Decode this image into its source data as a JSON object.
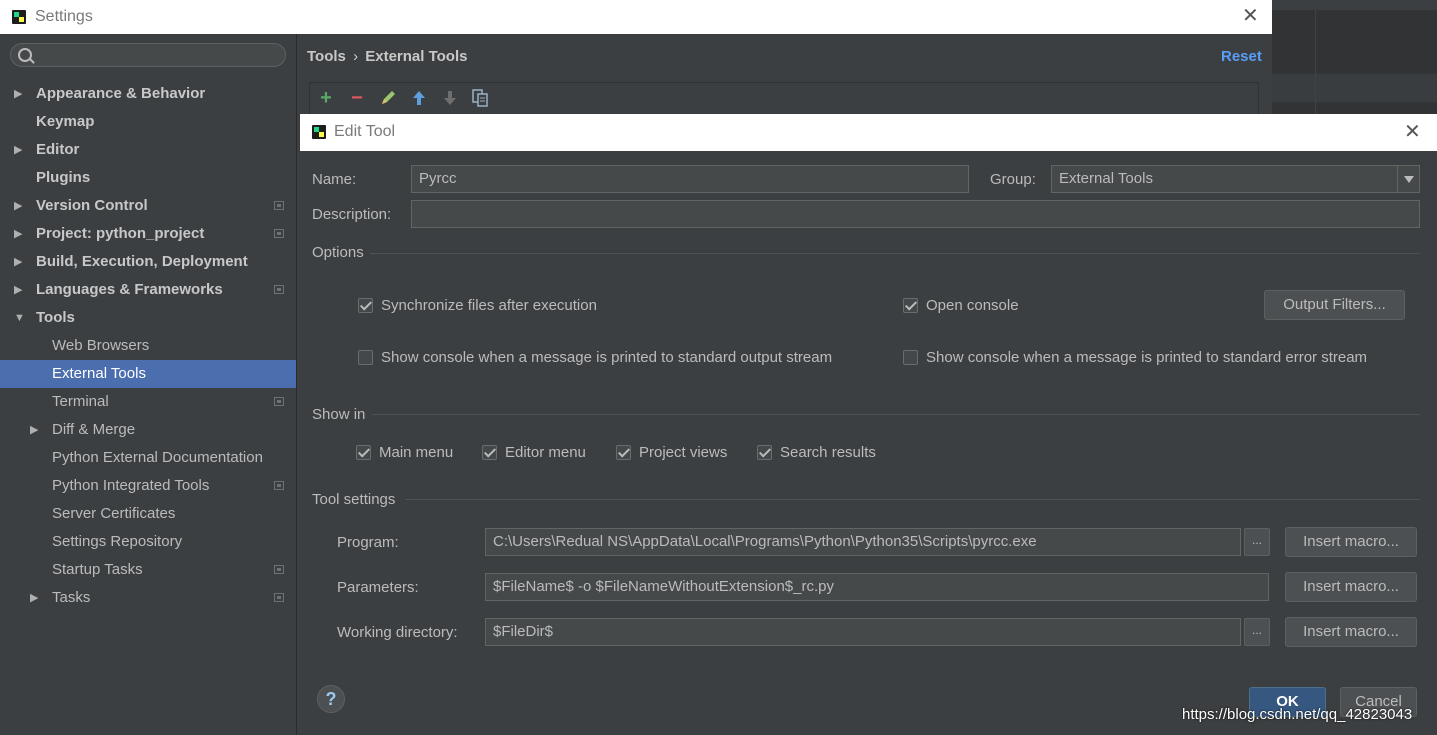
{
  "settings": {
    "title": "Settings",
    "search": {
      "placeholder": ""
    },
    "tree": [
      {
        "label": "Appearance & Behavior",
        "level": 0,
        "expandable": true,
        "bold": true,
        "project": false
      },
      {
        "label": "Keymap",
        "level": 0,
        "expandable": false,
        "bold": true,
        "project": false
      },
      {
        "label": "Editor",
        "level": 0,
        "expandable": true,
        "bold": true,
        "project": false
      },
      {
        "label": "Plugins",
        "level": 0,
        "expandable": false,
        "bold": true,
        "project": false
      },
      {
        "label": "Version Control",
        "level": 0,
        "expandable": true,
        "bold": true,
        "project": true
      },
      {
        "label": "Project: python_project",
        "level": 0,
        "expandable": true,
        "bold": true,
        "project": true
      },
      {
        "label": "Build, Execution, Deployment",
        "level": 0,
        "expandable": true,
        "bold": true,
        "project": false
      },
      {
        "label": "Languages & Frameworks",
        "level": 0,
        "expandable": true,
        "bold": true,
        "project": true
      },
      {
        "label": "Tools",
        "level": 0,
        "expandable": true,
        "expanded": true,
        "bold": true,
        "project": false
      },
      {
        "label": "Web Browsers",
        "level": 1,
        "expandable": false,
        "bold": false,
        "project": false
      },
      {
        "label": "External Tools",
        "level": 1,
        "expandable": false,
        "bold": false,
        "project": false,
        "selected": true
      },
      {
        "label": "Terminal",
        "level": 1,
        "expandable": false,
        "bold": false,
        "project": true
      },
      {
        "label": "Diff & Merge",
        "level": 1,
        "expandable": true,
        "bold": false,
        "project": false
      },
      {
        "label": "Python External Documentation",
        "level": 1,
        "expandable": false,
        "bold": false,
        "project": false
      },
      {
        "label": "Python Integrated Tools",
        "level": 1,
        "expandable": false,
        "bold": false,
        "project": true
      },
      {
        "label": "Server Certificates",
        "level": 1,
        "expandable": false,
        "bold": false,
        "project": false
      },
      {
        "label": "Settings Repository",
        "level": 1,
        "expandable": false,
        "bold": false,
        "project": false
      },
      {
        "label": "Startup Tasks",
        "level": 1,
        "expandable": false,
        "bold": false,
        "project": true
      },
      {
        "label": "Tasks",
        "level": 1,
        "expandable": true,
        "bold": false,
        "project": true
      }
    ],
    "breadcrumb": {
      "parent": "Tools",
      "separator": "›",
      "current": "External Tools"
    },
    "reset_label": "Reset",
    "toolbar_icons": [
      "add-icon",
      "remove-icon",
      "edit-icon",
      "move-up-icon",
      "move-down-icon",
      "copy-icon"
    ]
  },
  "dialog": {
    "title": "Edit Tool",
    "name_label": "Name:",
    "name_value": "Pyrcc",
    "group_label": "Group:",
    "group_value": "External Tools",
    "description_label": "Description:",
    "description_value": "",
    "options": {
      "title": "Options",
      "sync_files": {
        "label": "Synchronize files after execution",
        "checked": true
      },
      "open_console": {
        "label": "Open console",
        "checked": true
      },
      "output_filters_label": "Output Filters...",
      "show_console_stdout": {
        "label": "Show console when a message is printed to standard output stream",
        "checked": false
      },
      "show_console_stderr": {
        "label": "Show console when a message is printed to standard error stream",
        "checked": false
      }
    },
    "show_in": {
      "title": "Show in",
      "items": [
        {
          "label": "Main menu",
          "checked": true
        },
        {
          "label": "Editor menu",
          "checked": true
        },
        {
          "label": "Project views",
          "checked": true
        },
        {
          "label": "Search results",
          "checked": true
        }
      ]
    },
    "tool_settings": {
      "title": "Tool settings",
      "program_label": "Program:",
      "program_value": "C:\\Users\\Redual NS\\AppData\\Local\\Programs\\Python\\Python35\\Scripts\\pyrcc.exe",
      "parameters_label": "Parameters:",
      "parameters_value": "$FileName$ -o $FileNameWithoutExtension$_rc.py",
      "working_dir_label": "Working directory:",
      "working_dir_value": "$FileDir$",
      "browse_label": "...",
      "insert_macro_label": "Insert macro..."
    },
    "help_label": "?",
    "ok_label": "OK",
    "cancel_label": "Cancel"
  },
  "watermark": "https://blog.csdn.net/qq_42823043",
  "colors": {
    "accent": "#4b6eaf",
    "link": "#589df6",
    "add": "#59a869",
    "remove": "#db5860"
  }
}
